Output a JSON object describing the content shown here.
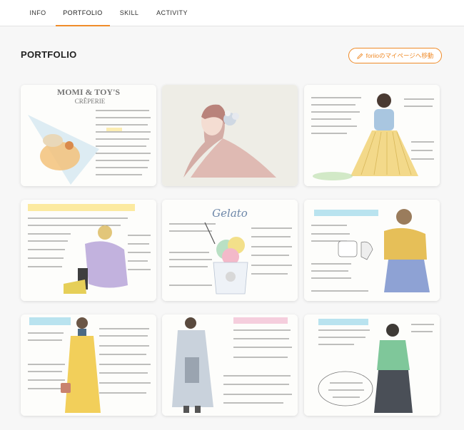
{
  "tabs": [
    {
      "label": "INFO"
    },
    {
      "label": "PORTFOLIO"
    },
    {
      "label": "SKILL"
    },
    {
      "label": "ACTIVITY"
    }
  ],
  "active_tab": "PORTFOLIO",
  "section": {
    "title": "PORTFOLIO",
    "button_label": "foriioのマイページへ移動"
  },
  "colors": {
    "accent": "#ef8a27",
    "background": "#f7f7f7"
  },
  "portfolio": {
    "items": [
      {
        "icon": "crepe-illustration",
        "heading": "MOMI & TOY'S",
        "subheading": "CRÊPERIE"
      },
      {
        "icon": "woman-portrait-illustration",
        "heading": "",
        "subheading": ""
      },
      {
        "icon": "pleated-skirt-outfit-illustration",
        "heading": "",
        "subheading": ""
      },
      {
        "icon": "purple-coat-illustration",
        "heading": "",
        "subheading": ""
      },
      {
        "icon": "gelato-illustration",
        "heading": "Gelato",
        "subheading": ""
      },
      {
        "icon": "yellow-sweater-illustration",
        "heading": "",
        "subheading": ""
      },
      {
        "icon": "yellow-dress-illustration",
        "heading": "",
        "subheading": ""
      },
      {
        "icon": "grey-coat-illustration",
        "heading": "",
        "subheading": ""
      },
      {
        "icon": "green-sweater-illustration",
        "heading": "",
        "subheading": ""
      }
    ]
  }
}
